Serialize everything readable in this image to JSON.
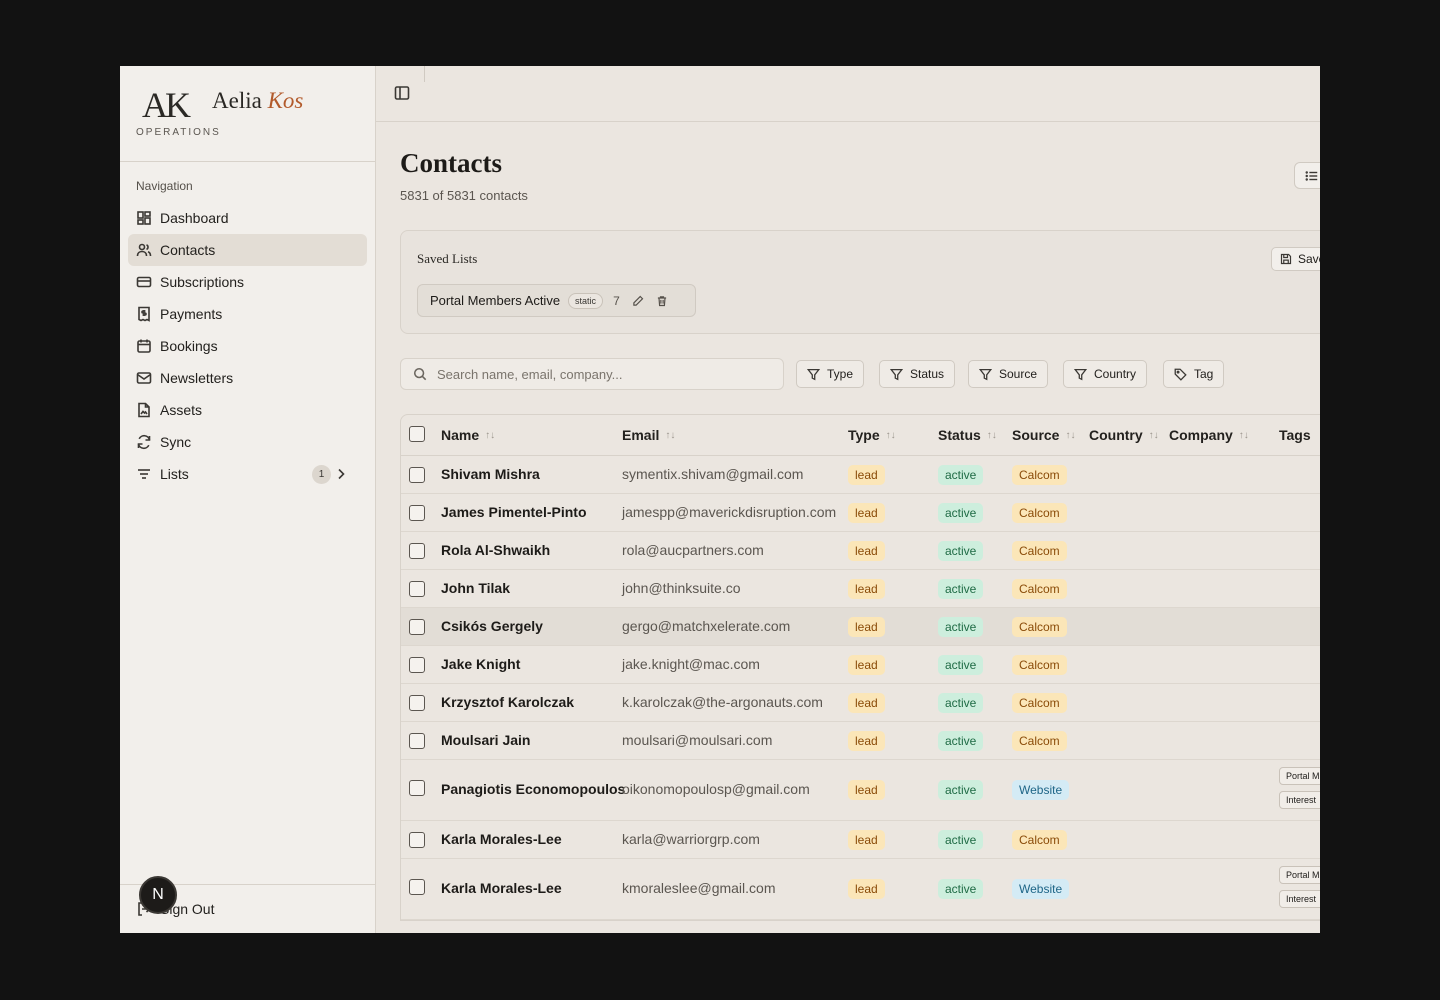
{
  "brand": {
    "mark": "AK",
    "first": "Aelia",
    "last": "Kos",
    "subtitle": "OPERATIONS"
  },
  "nav": {
    "heading": "Navigation",
    "items": [
      {
        "label": "Dashboard",
        "icon": "dashboard-icon"
      },
      {
        "label": "Contacts",
        "icon": "users-icon",
        "active": true
      },
      {
        "label": "Subscriptions",
        "icon": "credit-card-icon"
      },
      {
        "label": "Payments",
        "icon": "receipt-icon"
      },
      {
        "label": "Bookings",
        "icon": "calendar-icon"
      },
      {
        "label": "Newsletters",
        "icon": "mail-icon"
      },
      {
        "label": "Assets",
        "icon": "file-image-icon"
      },
      {
        "label": "Sync",
        "icon": "refresh-icon"
      },
      {
        "label": "Lists",
        "icon": "list-filter-icon",
        "badge": "1"
      }
    ],
    "signout": "Sign Out",
    "avatar": "N"
  },
  "page": {
    "title": "Contacts",
    "subtitle": "5831 of 5831 contacts"
  },
  "saved_lists": {
    "title": "Saved Lists",
    "save_label": "Save",
    "chip": {
      "name": "Portal Members Active",
      "badge": "static",
      "count": "7"
    }
  },
  "search": {
    "placeholder": "Search name, email, company..."
  },
  "filters": [
    "Type",
    "Status",
    "Source",
    "Country",
    "Tag"
  ],
  "table": {
    "columns": [
      "Name",
      "Email",
      "Type",
      "Status",
      "Source",
      "Country",
      "Company",
      "Tags"
    ],
    "rows": [
      {
        "name": "Shivam Mishra",
        "email": "symentix.shivam@gmail.com",
        "type": "lead",
        "status": "active",
        "source": "Calcom"
      },
      {
        "name": "James Pimentel-Pinto",
        "email": "jamespp@maverickdisruption.com",
        "type": "lead",
        "status": "active",
        "source": "Calcom"
      },
      {
        "name": "Rola Al-Shwaikh",
        "email": "rola@aucpartners.com",
        "type": "lead",
        "status": "active",
        "source": "Calcom"
      },
      {
        "name": "John Tilak",
        "email": "john@thinksuite.co",
        "type": "lead",
        "status": "active",
        "source": "Calcom"
      },
      {
        "name": "Csikós Gergely",
        "email": "gergo@matchxelerate.com",
        "type": "lead",
        "status": "active",
        "source": "Calcom"
      },
      {
        "name": "Jake Knight",
        "email": "jake.knight@mac.com",
        "type": "lead",
        "status": "active",
        "source": "Calcom"
      },
      {
        "name": "Krzysztof Karolczak",
        "email": "k.karolczak@the-argonauts.com",
        "type": "lead",
        "status": "active",
        "source": "Calcom"
      },
      {
        "name": "Moulsari Jain",
        "email": "moulsari@moulsari.com",
        "type": "lead",
        "status": "active",
        "source": "Calcom"
      },
      {
        "name": "Panagiotis Economopoulos",
        "email": "oikonomopoulosp@gmail.com",
        "type": "lead",
        "status": "active",
        "source": "Website",
        "tags": [
          "Portal M",
          "Interest"
        ]
      },
      {
        "name": "Karla Morales-Lee",
        "email": "karla@warriorgrp.com",
        "type": "lead",
        "status": "active",
        "source": "Calcom"
      },
      {
        "name": "Karla Morales-Lee",
        "email": "kmoraleslee@gmail.com",
        "type": "lead",
        "status": "active",
        "source": "Website",
        "tags": [
          "Portal M",
          "Interest"
        ]
      }
    ]
  }
}
